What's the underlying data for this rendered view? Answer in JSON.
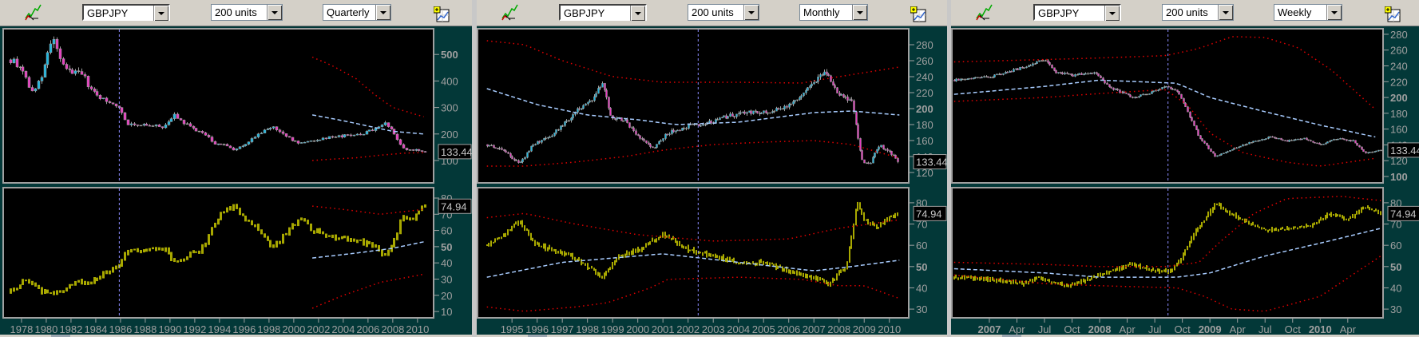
{
  "toolbars": [
    {
      "symbol": "GBPJPY",
      "units": "200 units",
      "period": "Quarterly"
    },
    {
      "symbol": "GBPJPY",
      "units": "200 units",
      "period": "Monthly"
    },
    {
      "symbol": "GBPJPY",
      "units": "200 units",
      "period": "Weekly"
    }
  ],
  "icons": {
    "left": "chart-drawing-tool-icon",
    "right": "add-chart-icon"
  },
  "colors": {
    "up": "#1fb8e0",
    "down": "#e83cc0",
    "wick": "#a0a0a0",
    "indicator": "#a8a800",
    "ma": "#a8ccff",
    "band": "#e00000",
    "cursor": "#8c8cff"
  },
  "chart_data": [
    {
      "type": "candlestick",
      "period": "Quarterly",
      "step": 0.25,
      "x_range": [
        1976.52,
        2011.3
      ],
      "x_ticks": [
        1978,
        1980,
        1982,
        1984,
        1986,
        1988,
        1990,
        1992,
        1994,
        1996,
        1998,
        2000,
        2002,
        2004,
        2006,
        2008,
        2010
      ],
      "x_tick_labels": [
        "1978",
        "1980",
        "1982",
        "1984",
        "1986",
        "1988",
        "1990",
        "1992",
        "1994",
        "1996",
        "1998",
        "2000",
        "2002",
        "2004",
        "2006",
        "2008",
        "2010"
      ],
      "x_tick_bold": [],
      "cursor_x": 1985.9,
      "price": {
        "ylim": [
          15.6,
          597
        ],
        "ticks": [
          100,
          200,
          300,
          400,
          500
        ],
        "tick_labels": [
          "100",
          "200",
          "300",
          "400",
          "500"
        ],
        "bold": [
          "500"
        ],
        "last": "133.44",
        "last_value": 133.44,
        "close": {
          "x": [
            1977.1,
            1978,
            1978.8,
            1979.5,
            1980.2,
            1980.6,
            1981.2,
            1982,
            1982.8,
            1983.5,
            1984.3,
            1985,
            1985.9,
            1986.5,
            1987.5,
            1988.5,
            1989.5,
            1990.3,
            1991,
            1992,
            1992.8,
            1993.5,
            1994.3,
            1995.2,
            1996,
            1997,
            1998.3,
            1998.9,
            1999.7,
            2000.5,
            2001.5,
            2002.5,
            2003.5,
            2004.5,
            2005.5,
            2006.5,
            2007.4,
            2008,
            2008.7,
            2009.2,
            2009.8,
            2010.6
          ],
          "y": [
            480,
            450,
            360,
            400,
            520,
            550,
            470,
            430,
            440,
            370,
            340,
            320,
            300,
            240,
            235,
            230,
            228,
            270,
            245,
            215,
            200,
            165,
            160,
            140,
            160,
            195,
            230,
            205,
            180,
            165,
            175,
            185,
            190,
            195,
            200,
            220,
            245,
            210,
            150,
            140,
            140,
            133.44
          ]
        },
        "ma": {
          "x": [
            2001.5,
            2004,
            2006,
            2008,
            2010.5
          ],
          "y": [
            272,
            250,
            230,
            210,
            200
          ]
        },
        "band_upper": {
          "x": [
            2001.5,
            2003,
            2005,
            2006.5,
            2008,
            2010.5
          ],
          "y": [
            490,
            460,
            410,
            350,
            300,
            265
          ]
        },
        "band_lower": {
          "x": [
            2001.5,
            2003,
            2005,
            2007,
            2009,
            2010.5
          ],
          "y": [
            100,
            105,
            110,
            120,
            128,
            130
          ]
        }
      },
      "indicator": {
        "ylim": [
          6.1,
          86.4
        ],
        "ticks": [
          10,
          20,
          30,
          40,
          50,
          60,
          70,
          80
        ],
        "tick_labels": [
          "10",
          "20",
          "30",
          "40",
          "50",
          "60",
          "70",
          "80"
        ],
        "bold": [
          "50"
        ],
        "last": "74.94",
        "last_value": 74.94,
        "values": {
          "x": [
            1977.1,
            1978.3,
            1979,
            1980.2,
            1981.5,
            1982.5,
            1983.2,
            1984.3,
            1985.3,
            1985.9,
            1986.5,
            1988,
            1989.5,
            1990.5,
            1991.5,
            1992.5,
            1993.3,
            1994.3,
            1995.2,
            1996,
            1997,
            1998.3,
            1999.2,
            2000.5,
            2001.5,
            2003,
            2005,
            2006.5,
            2007.3,
            2008.2,
            2008.7,
            2009.3,
            2010,
            2010.6
          ],
          "y": [
            22,
            30,
            25,
            20,
            24,
            28,
            27,
            32,
            36,
            40,
            48,
            47,
            49,
            39,
            45,
            48,
            60,
            72,
            75,
            68,
            62,
            48,
            58,
            68,
            60,
            56,
            54,
            50,
            44,
            55,
            70,
            65,
            72,
            74.94
          ]
        },
        "ma": {
          "x": [
            2001.5,
            2005,
            2008,
            2010.5
          ],
          "y": [
            43,
            46,
            49,
            53
          ]
        },
        "band_upper": {
          "x": [
            2001.5,
            2004,
            2007,
            2010.5
          ],
          "y": [
            75,
            73,
            70,
            73
          ]
        },
        "band_lower": {
          "x": [
            2001.5,
            2004,
            2007,
            2010.5
          ],
          "y": [
            12,
            20,
            28,
            33
          ]
        }
      }
    },
    {
      "type": "candlestick",
      "period": "Monthly",
      "step": 0.0833,
      "x_range": [
        1993.63,
        2010.77
      ],
      "x_ticks": [
        1995,
        1996,
        1997,
        1998,
        1999,
        2000,
        2001,
        2002,
        2003,
        2004,
        2005,
        2006,
        2007,
        2008,
        2009,
        2010
      ],
      "x_tick_labels": [
        "1995",
        "1996",
        "1997",
        "1998",
        "1999",
        "2000",
        "2001",
        "2002",
        "2003",
        "2004",
        "2005",
        "2006",
        "2007",
        "2008",
        "2009",
        "2010"
      ],
      "x_tick_bold": [],
      "cursor_x": 2002.4,
      "price": {
        "ylim": [
          107,
          300
        ],
        "ticks": [
          120,
          140,
          160,
          180,
          200,
          220,
          240,
          260,
          280
        ],
        "tick_labels": [
          "120",
          "140",
          "160",
          "180",
          "200",
          "220",
          "240",
          "260",
          "280"
        ],
        "bold": [
          "200"
        ],
        "last": "133.44",
        "last_value": 133.44,
        "close": {
          "x": [
            1994.0,
            1994.6,
            1995.3,
            1995.8,
            1996.5,
            1997.2,
            1997.6,
            1998.2,
            1998.6,
            1998.9,
            1999.5,
            2000.0,
            2000.6,
            2001.2,
            2002.0,
            2002.8,
            2003.5,
            2004.3,
            2005.0,
            2005.8,
            2006.5,
            2007.0,
            2007.5,
            2007.9,
            2008.5,
            2008.9,
            2009.2,
            2009.6,
            2010.0,
            2010.4
          ],
          "y": [
            155,
            150,
            130,
            155,
            165,
            185,
            200,
            210,
            235,
            190,
            185,
            165,
            150,
            170,
            178,
            182,
            190,
            195,
            195,
            202,
            215,
            235,
            245,
            220,
            210,
            135,
            130,
            155,
            145,
            133.44
          ]
        },
        "ma": {
          "x": [
            1994.0,
            1996,
            1998,
            2000,
            2001.5,
            2004,
            2007,
            2008.5,
            2010.4
          ],
          "y": [
            225,
            205,
            192,
            186,
            180,
            183,
            195,
            197,
            192
          ]
        },
        "band_upper": {
          "x": [
            1994.0,
            1995.5,
            1997,
            1999,
            2001,
            2004,
            2006.5,
            2008,
            2010.4
          ],
          "y": [
            285,
            280,
            260,
            240,
            233,
            233,
            232,
            240,
            252
          ]
        },
        "band_lower": {
          "x": [
            1994.0,
            1995.5,
            1997.5,
            1999.5,
            2001,
            2003,
            2005,
            2007,
            2008.5,
            2010.4
          ],
          "y": [
            128,
            128,
            133,
            140,
            148,
            155,
            158,
            160,
            155,
            138
          ]
        }
      },
      "indicator": {
        "ylim": [
          25.9,
          87.1
        ],
        "ticks": [
          30,
          40,
          50,
          60,
          70,
          80
        ],
        "tick_labels": [
          "30",
          "40",
          "50",
          "60",
          "70",
          "80"
        ],
        "bold": [
          "50"
        ],
        "last": "74.94",
        "last_value": 74.94,
        "values": {
          "x": [
            1994.0,
            1994.7,
            1995.3,
            1995.8,
            1996.5,
            1997.2,
            1998.0,
            1998.6,
            1999.2,
            2000.0,
            2001.0,
            2002.0,
            2003.0,
            2004.0,
            2005.0,
            2006.0,
            2007.0,
            2007.6,
            2008.3,
            2008.7,
            2009.0,
            2009.5,
            2010.0,
            2010.4
          ],
          "y": [
            60,
            65,
            72,
            62,
            58,
            56,
            50,
            45,
            54,
            58,
            65,
            58,
            55,
            52,
            52,
            48,
            45,
            42,
            50,
            80,
            72,
            68,
            73,
            74.94
          ]
        },
        "ma": {
          "x": [
            1994.0,
            1997,
            2001,
            2004,
            2007,
            2008.5,
            2010.4
          ],
          "y": [
            45,
            52,
            56,
            52,
            48,
            50,
            53
          ]
        },
        "band_upper": {
          "x": [
            1994.0,
            1995.5,
            1997.5,
            2000,
            2003,
            2006,
            2008,
            2010.4
          ],
          "y": [
            73,
            75,
            70,
            65,
            62,
            63,
            68,
            72
          ]
        },
        "band_lower": {
          "x": [
            1994.0,
            1995.5,
            1997.5,
            1998.8,
            2000.5,
            2001.2,
            2004,
            2006.5,
            2008.0,
            2009,
            2010.4
          ],
          "y": [
            31,
            29,
            31,
            33,
            40,
            44,
            45,
            44,
            41,
            41,
            35
          ]
        }
      }
    },
    {
      "type": "candlestick",
      "period": "Weekly",
      "step": 0.01923,
      "x_range": [
        2006.66,
        2010.57
      ],
      "x_ticks": [
        2007,
        2007.25,
        2007.5,
        2007.75,
        2008,
        2008.25,
        2008.5,
        2008.75,
        2009,
        2009.25,
        2009.5,
        2009.75,
        2010,
        2010.25
      ],
      "x_tick_labels": [
        "2007",
        "Apr",
        "Jul",
        "Oct",
        "2008",
        "Apr",
        "Jul",
        "Oct",
        "2009",
        "Apr",
        "Jul",
        "Oct",
        "2010",
        "Apr"
      ],
      "x_tick_bold": [
        "2007",
        "2008",
        "2009",
        "2010"
      ],
      "cursor_x": 2008.62,
      "price": {
        "ylim": [
          91.9,
          287
        ],
        "ticks": [
          100,
          120,
          140,
          160,
          180,
          200,
          220,
          240,
          260,
          280
        ],
        "tick_labels": [
          "100",
          "120",
          "140",
          "160",
          "180",
          "200",
          "220",
          "240",
          "260",
          "280"
        ],
        "bold": [
          "100",
          "200"
        ],
        "last": "133.44",
        "last_value": 133.44,
        "close": {
          "x": [
            2006.68,
            2007.0,
            2007.3,
            2007.5,
            2007.6,
            2007.75,
            2007.95,
            2008.1,
            2008.3,
            2008.45,
            2008.6,
            2008.72,
            2008.8,
            2008.9,
            2009.05,
            2009.2,
            2009.4,
            2009.55,
            2009.7,
            2009.85,
            2010.0,
            2010.15,
            2010.3,
            2010.4,
            2010.55
          ],
          "y": [
            222,
            226,
            238,
            248,
            232,
            228,
            232,
            212,
            200,
            205,
            215,
            205,
            180,
            150,
            125,
            135,
            145,
            150,
            145,
            148,
            140,
            148,
            145,
            130,
            133.44
          ]
        },
        "ma": {
          "x": [
            2006.68,
            2007.5,
            2008.0,
            2008.7,
            2009.0,
            2009.5,
            2010.0,
            2010.5
          ],
          "y": [
            204,
            214,
            222,
            218,
            200,
            182,
            165,
            150
          ]
        },
        "band_upper": {
          "x": [
            2006.68,
            2007.5,
            2008.0,
            2008.6,
            2008.9,
            2009.2,
            2009.5,
            2009.8,
            2010.1,
            2010.5
          ],
          "y": [
            245,
            248,
            250,
            253,
            262,
            277,
            276,
            263,
            235,
            185
          ]
        },
        "band_lower": {
          "x": [
            2006.68,
            2007.5,
            2008.0,
            2008.6,
            2008.8,
            2009.0,
            2009.3,
            2009.7,
            2010.0,
            2010.5
          ],
          "y": [
            195,
            200,
            205,
            210,
            190,
            155,
            130,
            118,
            113,
            123
          ]
        }
      },
      "indicator": {
        "ylim": [
          25.9,
          87.1
        ],
        "ticks": [
          30,
          40,
          50,
          60,
          70,
          80
        ],
        "tick_labels": [
          "30",
          "40",
          "50",
          "60",
          "70",
          "80"
        ],
        "bold": [
          "50"
        ],
        "last": "74.94",
        "last_value": 74.94,
        "values": {
          "x": [
            2006.68,
            2007.0,
            2007.3,
            2007.45,
            2007.55,
            2007.7,
            2007.9,
            2008.1,
            2008.3,
            2008.5,
            2008.65,
            2008.75,
            2008.85,
            2008.95,
            2009.05,
            2009.15,
            2009.3,
            2009.5,
            2009.7,
            2009.9,
            2010.1,
            2010.25,
            2010.4,
            2010.55
          ],
          "y": [
            45,
            44,
            42,
            45,
            43,
            41,
            44,
            48,
            51,
            48,
            48,
            55,
            65,
            72,
            80,
            76,
            72,
            67,
            68,
            69,
            75,
            72,
            78,
            74.94
          ]
        },
        "ma": {
          "x": [
            2006.68,
            2007.5,
            2008.0,
            2008.7,
            2009.0,
            2009.5,
            2010.0,
            2010.55
          ],
          "y": [
            49,
            47,
            45,
            45,
            47,
            55,
            61,
            68
          ]
        },
        "band_upper": {
          "x": [
            2006.68,
            2007.5,
            2008.0,
            2008.6,
            2008.9,
            2009.1,
            2009.4,
            2009.7,
            2010.2,
            2010.55
          ],
          "y": [
            52,
            51,
            50,
            50,
            52,
            62,
            75,
            82,
            83,
            81
          ]
        },
        "band_lower": {
          "x": [
            2006.68,
            2007.5,
            2008.0,
            2008.7,
            2008.95,
            2009.2,
            2009.5,
            2010.0,
            2010.55
          ],
          "y": [
            46,
            42,
            41,
            40,
            36,
            30,
            29,
            36,
            55
          ]
        }
      }
    }
  ]
}
